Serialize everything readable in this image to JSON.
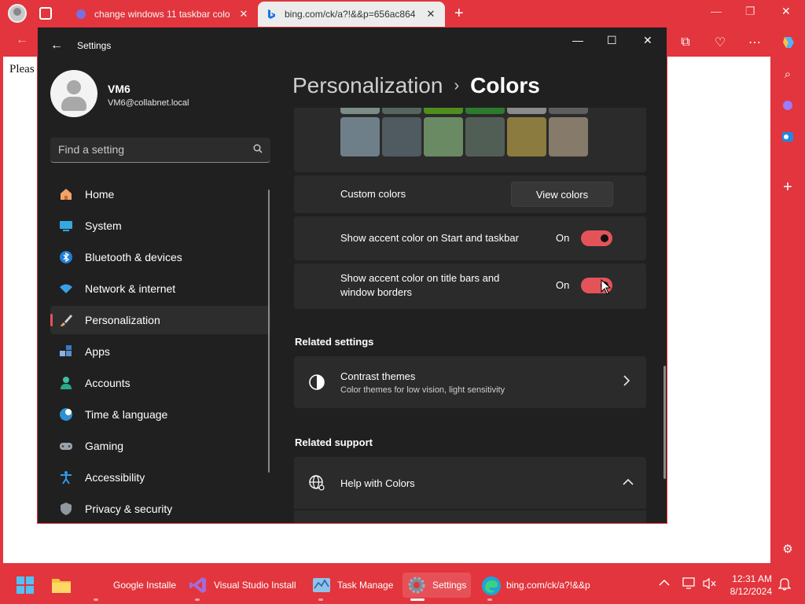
{
  "browser": {
    "tabs": [
      {
        "title": "change windows 11 taskbar colo",
        "active": false
      },
      {
        "title": "bing.com/ck/a?!&&p=656ac864",
        "active": true
      }
    ],
    "page_text": "Pleas"
  },
  "settings": {
    "window_title": "Settings",
    "user": {
      "name": "VM6",
      "email": "VM6@collabnet.local"
    },
    "search_placeholder": "Find a setting",
    "nav": [
      {
        "label": "Home",
        "icon": "home-icon",
        "active": false
      },
      {
        "label": "System",
        "icon": "system-icon",
        "active": false
      },
      {
        "label": "Bluetooth & devices",
        "icon": "bluetooth-icon",
        "active": false
      },
      {
        "label": "Network & internet",
        "icon": "wifi-icon",
        "active": false
      },
      {
        "label": "Personalization",
        "icon": "brush-icon",
        "active": true
      },
      {
        "label": "Apps",
        "icon": "apps-icon",
        "active": false
      },
      {
        "label": "Accounts",
        "icon": "accounts-icon",
        "active": false
      },
      {
        "label": "Time & language",
        "icon": "globe-clock-icon",
        "active": false
      },
      {
        "label": "Gaming",
        "icon": "gamepad-icon",
        "active": false
      },
      {
        "label": "Accessibility",
        "icon": "accessibility-icon",
        "active": false
      },
      {
        "label": "Privacy & security",
        "icon": "shield-icon",
        "active": false
      }
    ],
    "breadcrumb": {
      "parent": "Personalization",
      "separator": "›",
      "current": "Colors"
    },
    "swatch_colors_top": [
      "#7a8d87",
      "#53665f",
      "#4f8d1c",
      "#2d7a2e",
      "#8a8a8a",
      "#5e5e5e"
    ],
    "swatch_colors": [
      "#6f7f89",
      "#4f5a61",
      "#6a8a63",
      "#515e56",
      "#8c7b3e",
      "#867a6a"
    ],
    "custom_colors": {
      "label": "Custom colors",
      "button": "View colors"
    },
    "accent_start_taskbar": {
      "label": "Show accent color on Start and taskbar",
      "state": "On",
      "checked": true
    },
    "accent_title_bars": {
      "label_line1": "Show accent color on title bars and",
      "label_line2": "window borders",
      "state": "On",
      "checked": true
    },
    "related_settings": {
      "heading": "Related settings",
      "contrast_title": "Contrast themes",
      "contrast_sub": "Color themes for low vision, light sensitivity"
    },
    "related_support": {
      "heading": "Related support",
      "help_title": "Help with Colors"
    },
    "accent_color": "#e5535a"
  },
  "taskbar": {
    "items": [
      {
        "label": "Google Installe"
      },
      {
        "label": "Visual Studio Install"
      },
      {
        "label": "Task Manage"
      },
      {
        "label": "Settings"
      },
      {
        "label": "bing.com/ck/a?!&&p"
      }
    ],
    "time": "12:31 AM",
    "date": "8/12/2024"
  },
  "theme": {
    "accent": "#e2353d",
    "window_bg": "#202020",
    "card_bg": "#2b2b2b"
  }
}
